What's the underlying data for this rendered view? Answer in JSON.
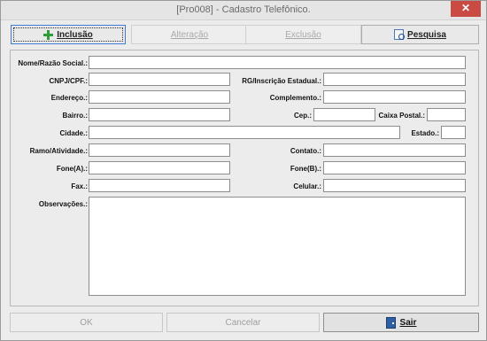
{
  "window": {
    "title": "[Pro008] - Cadastro Telefônico.",
    "close_label": "✕"
  },
  "toolbar": {
    "inclusao": "Inclusão",
    "alteracao": "Alteração",
    "exclusao": "Exclusão",
    "pesquisa": "Pesquisa"
  },
  "form": {
    "nome_label": "Nome/Razão Social.:",
    "cnpj_label": "CNPJ/CPF.:",
    "rg_label": "RG/Inscrição Estadual.:",
    "endereco_label": "Endereço.:",
    "complemento_label": "Complemento.:",
    "bairro_label": "Bairro.:",
    "cep_label": "Cep.:",
    "caixa_postal_label": "Caixa Postal.:",
    "cidade_label": "Cidade.:",
    "estado_label": "Estado.:",
    "ramo_label": "Ramo/Atividade.:",
    "contato_label": "Contato.:",
    "fone_a_label": "Fone(A).:",
    "fone_b_label": "Fone(B).:",
    "fax_label": "Fax.:",
    "celular_label": "Celular.:",
    "observacoes_label": "Observações.:"
  },
  "bottom": {
    "ok": "OK",
    "cancelar": "Cancelar",
    "sair": "Sair"
  }
}
